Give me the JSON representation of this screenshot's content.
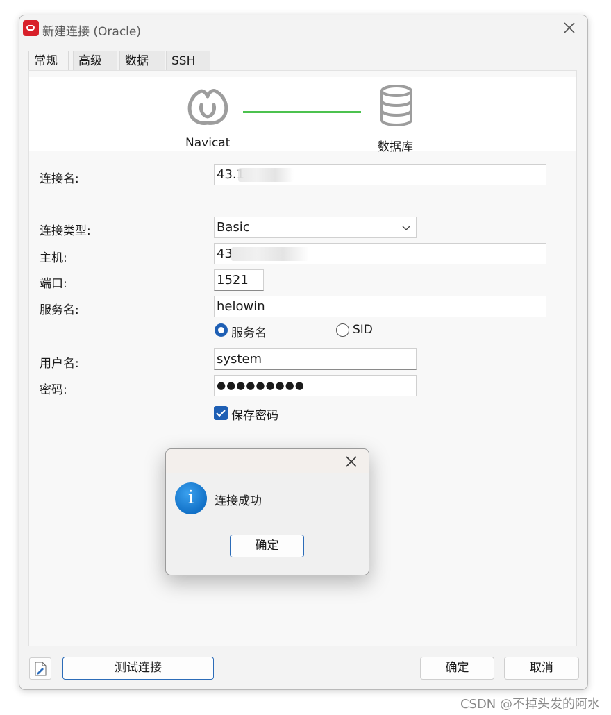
{
  "window": {
    "title": "新建连接 (Oracle)",
    "app_icon": "oracle-logo-icon"
  },
  "tabs": [
    {
      "label": "常规",
      "active": true
    },
    {
      "label": "高级",
      "active": false
    },
    {
      "label": "数据库",
      "active": false
    },
    {
      "label": "SSH",
      "active": false
    }
  ],
  "diagram": {
    "left_label": "Navicat",
    "right_label": "数据库",
    "left_icon": "navicat-logo-icon",
    "right_icon": "database-icon",
    "line_color": "#4cc24f"
  },
  "form": {
    "connection_name_label": "连接名:",
    "connection_name_value": "43.1",
    "connection_type_label": "连接类型:",
    "connection_type_value": "Basic",
    "host_label": "主机:",
    "host_value": "43",
    "port_label": "端口:",
    "port_value": "1521",
    "service_name_label": "服务名:",
    "service_name_value": "helowin",
    "radio_service_name_label": "服务名",
    "radio_sid_label": "SID",
    "radio_selected": "服务名",
    "username_label": "用户名:",
    "username_value": "system",
    "password_label": "密码:",
    "password_value": "●●●●●●●●●",
    "save_password_label": "保存密码",
    "save_password_checked": true
  },
  "footer": {
    "test_button": "测试连接",
    "ok_button": "确定",
    "cancel_button": "取消"
  },
  "message_box": {
    "message": "连接成功",
    "ok_button": "确定",
    "icon": "info-icon",
    "icon_glyph": "i"
  },
  "watermark": "CSDN @不掉头发的阿水",
  "colors": {
    "accent": "#1e5fb4",
    "app_icon_red": "#d8202a"
  }
}
